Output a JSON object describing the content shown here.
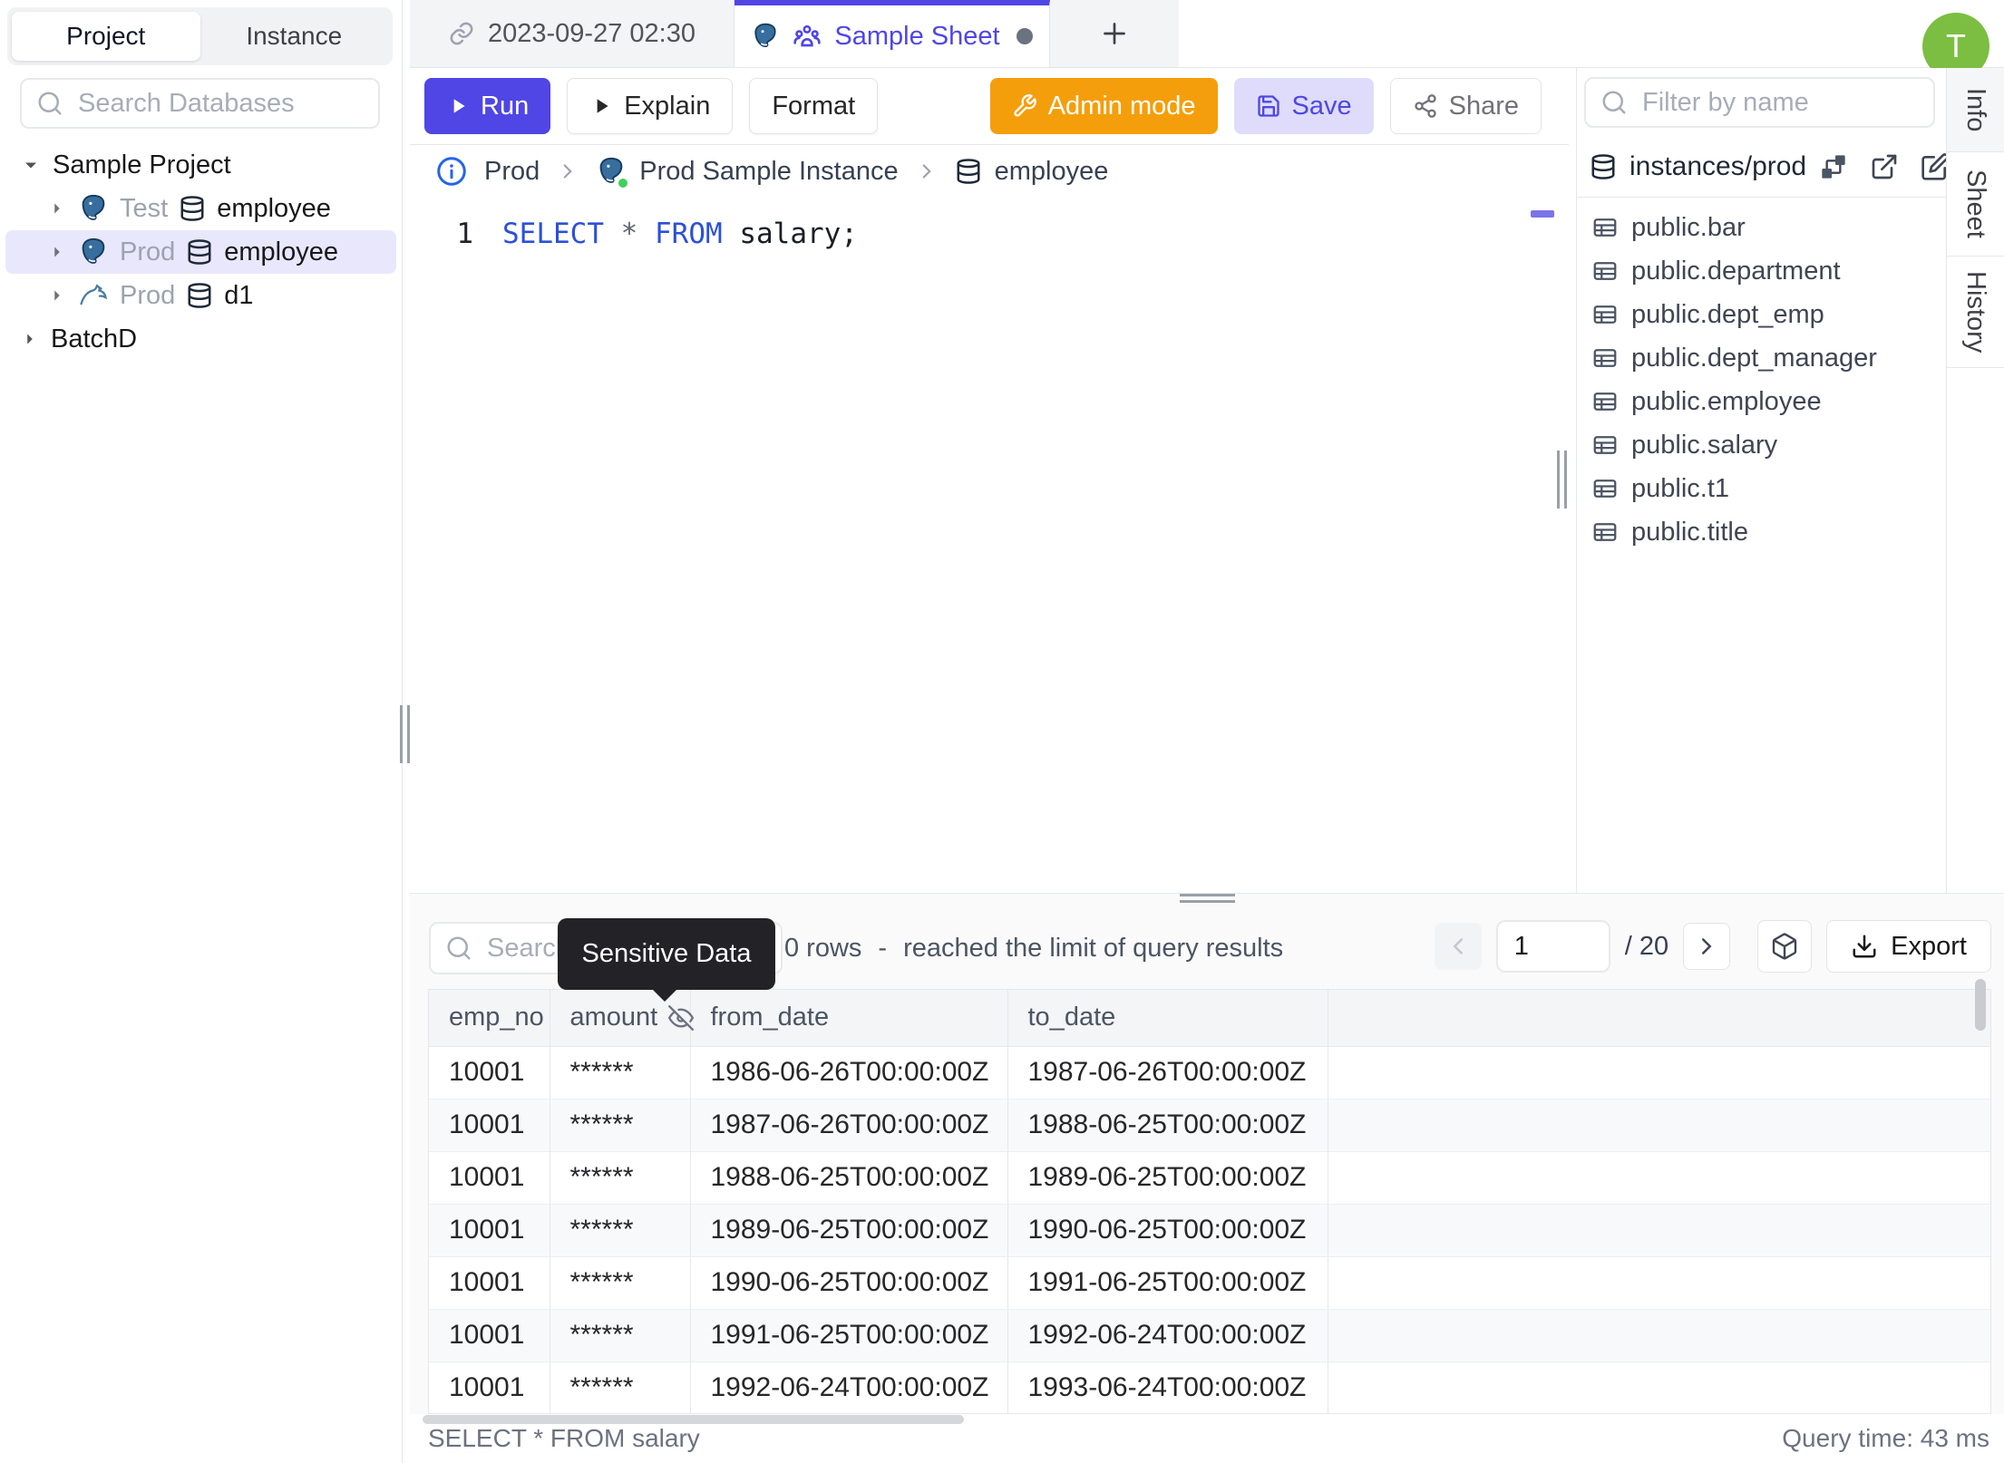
{
  "colors": {
    "accent": "#4f46e5",
    "admin_mode": "#f59e0b",
    "avatar_bg": "#7cbe41",
    "selected_tree_bg": "#e9e7fc",
    "keyword_blue": "#2c50d8",
    "tooltip_bg": "#232327"
  },
  "left_sidebar": {
    "tab_project": "Project",
    "tab_instance": "Instance",
    "search_placeholder": "Search Databases",
    "tree": {
      "root": "Sample Project",
      "items": [
        {
          "env": "Test",
          "db": "employee",
          "engine": "postgresql"
        },
        {
          "env": "Prod",
          "db": "employee",
          "engine": "postgresql"
        },
        {
          "env": "Prod",
          "db": "d1",
          "engine": "mysql"
        }
      ],
      "batch": "BatchD"
    }
  },
  "topbar": {
    "tab_datetime": "2023-09-27 02:30",
    "tab_sheet": "Sample Sheet",
    "avatar_initial": "T"
  },
  "toolbar": {
    "run": "Run",
    "explain": "Explain",
    "format": "Format",
    "admin_mode": "Admin mode",
    "save": "Save",
    "share": "Share"
  },
  "breadcrumb": {
    "environment": "Prod",
    "instance": "Prod Sample Instance",
    "database": "employee"
  },
  "editor": {
    "line_number": "1",
    "kw_select": "SELECT",
    "star": "*",
    "kw_from": "FROM",
    "table_ref": "salary;"
  },
  "right_sidebar": {
    "filter_placeholder": "Filter by name",
    "header": "instances/prod",
    "tables": [
      "public.bar",
      "public.department",
      "public.dept_emp",
      "public.dept_manager",
      "public.employee",
      "public.salary",
      "public.t1",
      "public.title"
    ]
  },
  "right_tabs": {
    "info": "Info",
    "sheet": "Sheet",
    "history": "History"
  },
  "results": {
    "search_placeholder": "Search",
    "tooltip": "Sensitive Data",
    "row_count": "0 rows",
    "dash": "-",
    "limit_message": "reached the limit of query results",
    "page_value": "1",
    "page_total": "/ 20",
    "export_label": "Export",
    "columns": [
      "emp_no",
      "amount",
      "from_date",
      "to_date"
    ],
    "rows": [
      [
        "10001",
        "******",
        "1986-06-26T00:00:00Z",
        "1987-06-26T00:00:00Z"
      ],
      [
        "10001",
        "******",
        "1987-06-26T00:00:00Z",
        "1988-06-25T00:00:00Z"
      ],
      [
        "10001",
        "******",
        "1988-06-25T00:00:00Z",
        "1989-06-25T00:00:00Z"
      ],
      [
        "10001",
        "******",
        "1989-06-25T00:00:00Z",
        "1990-06-25T00:00:00Z"
      ],
      [
        "10001",
        "******",
        "1990-06-25T00:00:00Z",
        "1991-06-25T00:00:00Z"
      ],
      [
        "10001",
        "******",
        "1991-06-25T00:00:00Z",
        "1992-06-24T00:00:00Z"
      ],
      [
        "10001",
        "******",
        "1992-06-24T00:00:00Z",
        "1993-06-24T00:00:00Z"
      ]
    ]
  },
  "statusbar": {
    "query_text": "SELECT * FROM salary",
    "query_time": "Query time: 43 ms"
  }
}
